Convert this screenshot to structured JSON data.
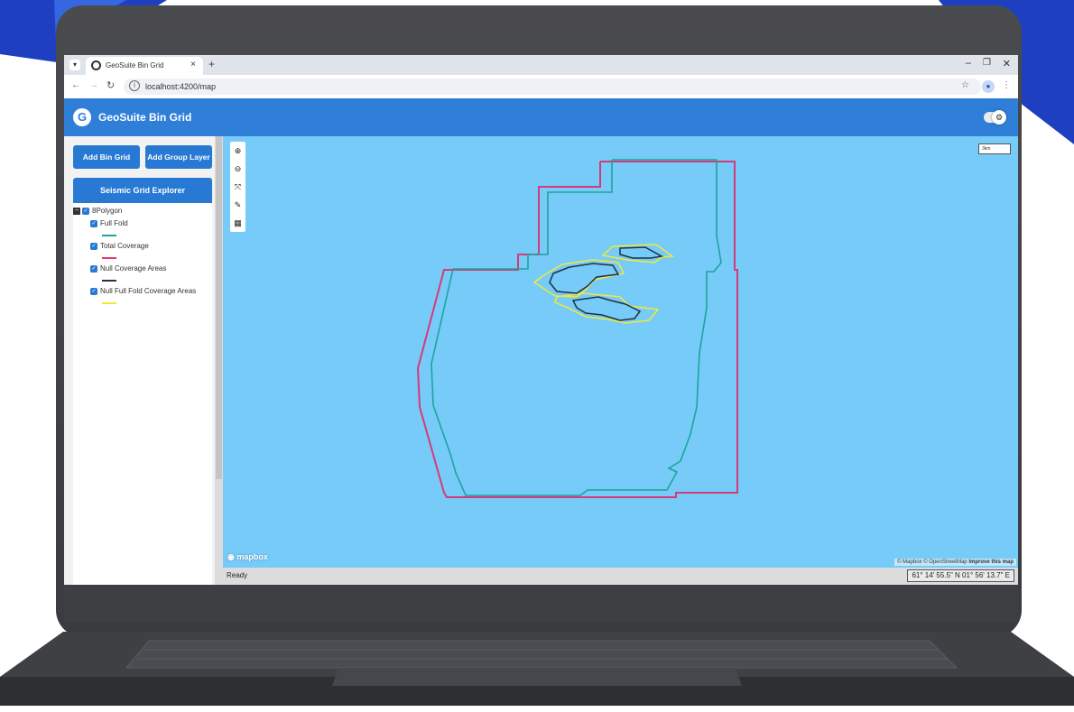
{
  "browser": {
    "tab_title": "GeoSuite Bin Grid",
    "tab_close": "×",
    "new_tab": "+",
    "url": "localhost:4200/map",
    "icons": [
      "chevron-down-icon",
      "back-arrow-icon",
      "forward-arrow-icon",
      "reload-icon",
      "info-icon",
      "star-icon",
      "profile-icon",
      "kebab-icon"
    ]
  },
  "app": {
    "title": "GeoSuite Bin Grid",
    "logo_letter": "G",
    "accent_color": "#2f7fd8"
  },
  "sidebar": {
    "add_bin_grid": "Add Bin Grid",
    "add_group_layer": "Add Group Layer",
    "explorer_title": "Seismic Grid Explorer",
    "tree": {
      "root": "8Polygon",
      "layers": [
        {
          "label": "Full Fold",
          "color": "#1ca59a"
        },
        {
          "label": "Total Coverage",
          "color": "#e8336b"
        },
        {
          "label": "Null Coverage Areas",
          "color": "#2b3040"
        },
        {
          "label": "Null Full Fold Coverage Areas",
          "color": "#f2e83b"
        }
      ]
    }
  },
  "map": {
    "background_color": "#76cbf9",
    "tools": [
      "zoom-in-icon",
      "zoom-out-icon",
      "fullscreen-icon",
      "measure-icon",
      "grid-icon"
    ],
    "scale_label": "3km",
    "mapbox_label": "mapbox",
    "attribution": "© Mapbox © OpenStreetMap",
    "attribution_link": "Improve this map"
  },
  "status": {
    "text": "Ready",
    "coordinates": "61° 14' 55.5\" N 01° 56' 13.7\" E"
  }
}
